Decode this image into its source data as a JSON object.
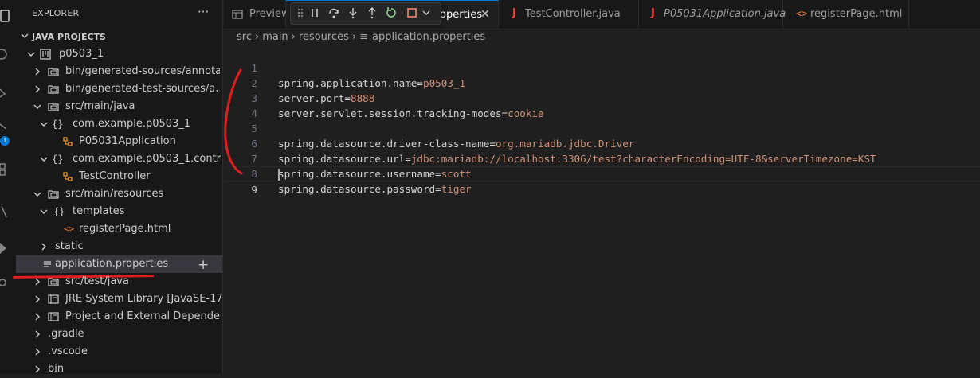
{
  "sidebar": {
    "title": "EXPLORER",
    "more": "···",
    "section": "JAVA PROJECTS",
    "tree": [
      {
        "label": "p0503_1"
      },
      {
        "label": "bin/generated-sources/annota..."
      },
      {
        "label": "bin/generated-test-sources/a..."
      },
      {
        "label": "src/main/java"
      },
      {
        "label": "com.example.p0503_1"
      },
      {
        "label": "P05031Application"
      },
      {
        "label": "com.example.p0503_1.contro..."
      },
      {
        "label": "TestController"
      },
      {
        "label": "src/main/resources"
      },
      {
        "label": "templates"
      },
      {
        "label": "registerPage.html"
      },
      {
        "label": "static"
      },
      {
        "label": "application.properties"
      },
      {
        "label": "src/test/java"
      },
      {
        "label": "JRE System Library [JavaSE-17]"
      },
      {
        "label": "Project and External Depende..."
      },
      {
        "label": ".gradle"
      },
      {
        "label": ".vscode"
      },
      {
        "label": "bin"
      }
    ],
    "badge": "1"
  },
  "tabs": [
    {
      "label": "Preview"
    },
    {
      "label": "roperties"
    },
    {
      "label": "TestController.java"
    },
    {
      "label": "P05031Application.java"
    },
    {
      "label": "registerPage.html"
    }
  ],
  "breadcrumb": [
    "src",
    "main",
    "resources",
    "application.properties"
  ],
  "code": [
    {
      "n": "1",
      "key": "spring.application.name=",
      "val": "p0503_1"
    },
    {
      "n": "2",
      "key": "server.port=",
      "val": "8888"
    },
    {
      "n": "3",
      "key": "server.servlet.session.tracking-modes=",
      "val": "cookie"
    },
    {
      "n": "4",
      "key": "",
      "val": ""
    },
    {
      "n": "5",
      "key": "spring.datasource.driver-class-name=",
      "val": "org.mariadb.jdbc.Driver"
    },
    {
      "n": "6",
      "key": "spring.datasource.url=",
      "val": "jdbc:mariadb://localhost:3306/test?characterEncoding=UTF-8&serverTimezone=KST"
    },
    {
      "n": "7",
      "key": "spring.datasource.username=",
      "val": "scott"
    },
    {
      "n": "8",
      "key": "spring.datasource.password=",
      "val": "tiger"
    },
    {
      "n": "9",
      "key": "",
      "val": ""
    }
  ]
}
